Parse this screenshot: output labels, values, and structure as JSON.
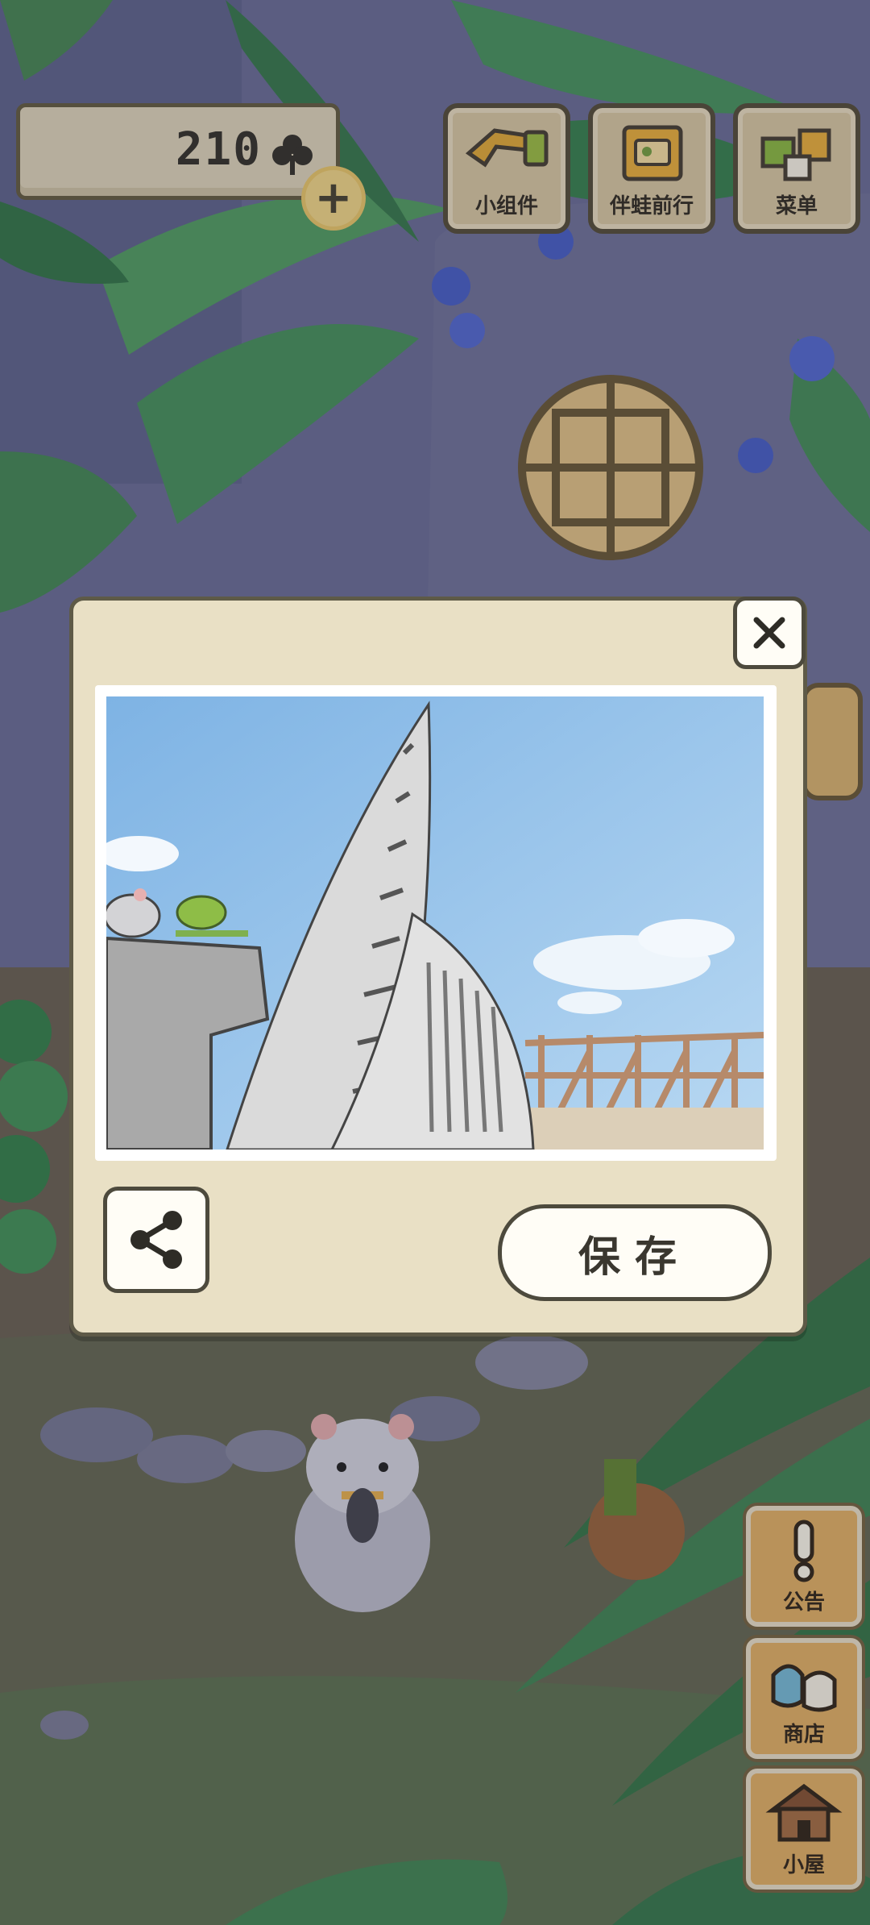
{
  "hud": {
    "clover_count": "210",
    "plus_label": "+"
  },
  "top_menu": [
    {
      "label": "小组件",
      "icon": "widget-icon"
    },
    {
      "label": "伴蛙前行",
      "icon": "journey-book-icon"
    },
    {
      "label": "菜单",
      "icon": "menu-cards-icon"
    }
  ],
  "side_menu": [
    {
      "label": "公告",
      "icon": "exclamation-icon"
    },
    {
      "label": "商店",
      "icon": "shop-bags-icon"
    },
    {
      "label": "小屋",
      "icon": "house-icon"
    }
  ],
  "dialog": {
    "close_label": "✕",
    "photo_description_icon": "photo-frog-hamster-bridge",
    "save_label": "保存"
  },
  "colors": {
    "panel": "#e9e0c5",
    "border": "#5e5a47",
    "button_wood": "#e2b369"
  }
}
